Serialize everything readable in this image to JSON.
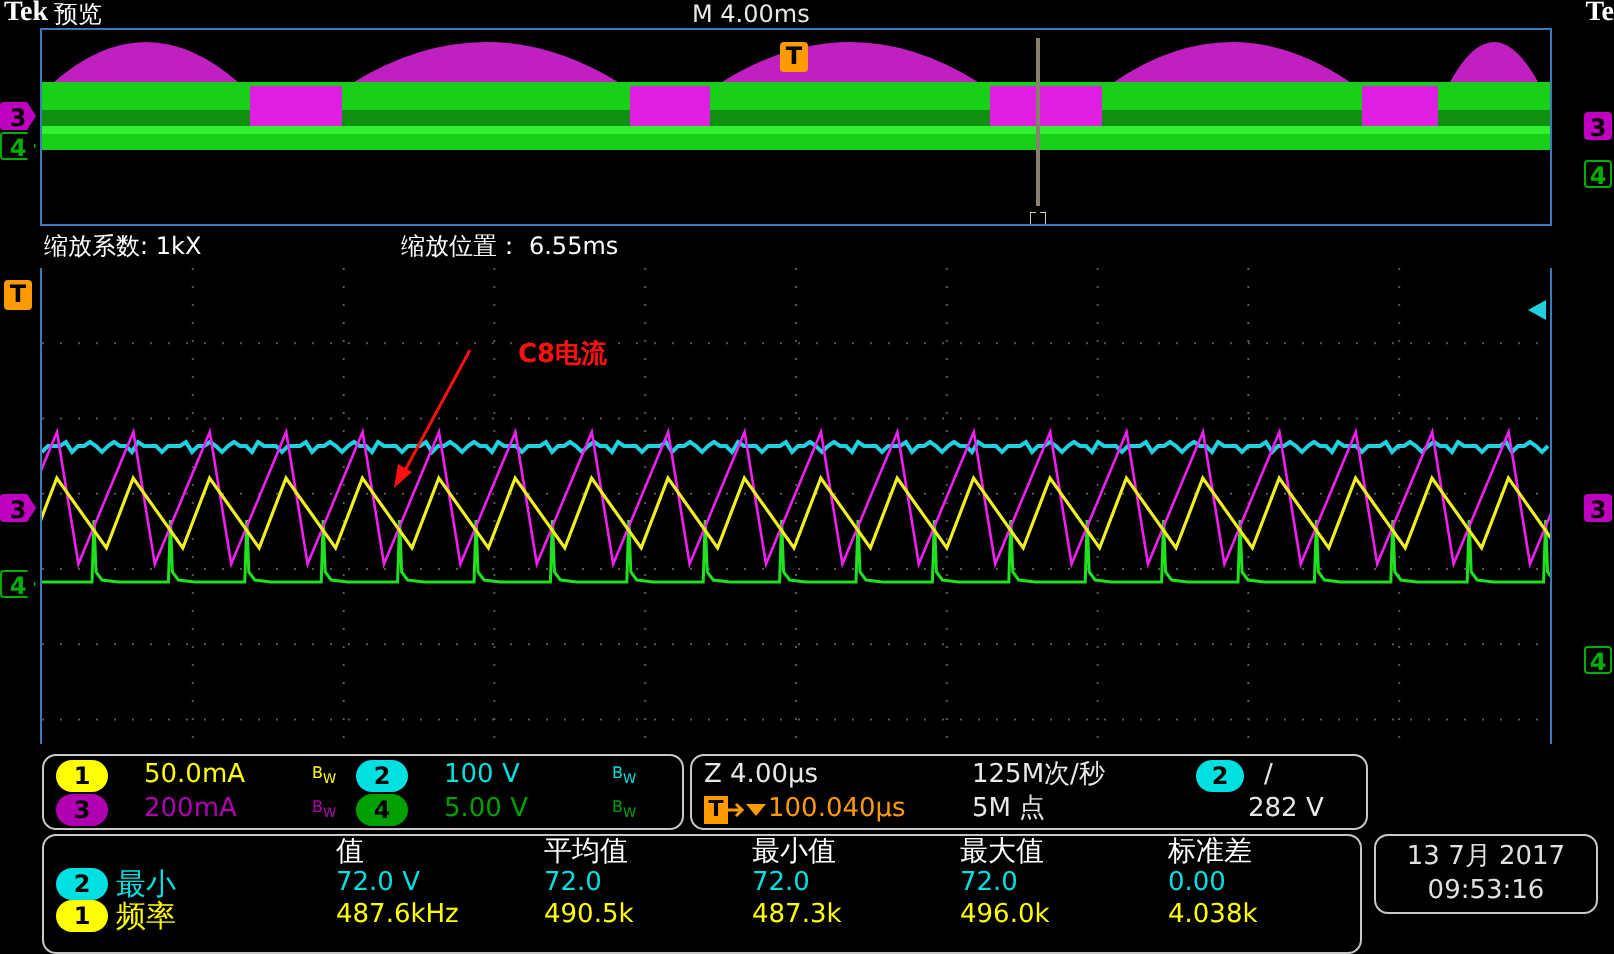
{
  "header": {
    "brand": "Tek",
    "title": "预览",
    "timebase": "M 4.00ms",
    "right_brand": "Te"
  },
  "overview": {
    "trigger": "T",
    "left_markers": [
      {
        "label": "3",
        "color": "#c000c0"
      },
      {
        "label": "4",
        "color": "#00b000"
      }
    ],
    "right_markers": [
      {
        "label": "3",
        "color": "#c000c0"
      },
      {
        "label": "4",
        "color": "#00b000"
      }
    ]
  },
  "zoom": {
    "factor": "缩放系数: 1kX",
    "position": "缩放位置： 6.55ms"
  },
  "display": {
    "trigger": "T",
    "annotation": "C8电流",
    "left_markers": [
      {
        "label": "3",
        "color": "#c000c0"
      },
      {
        "label": "4",
        "color": "#00b000"
      }
    ],
    "right_markers": [
      {
        "label": "3",
        "color": "#c000c0"
      },
      {
        "label": "4",
        "color": "#00b000"
      }
    ]
  },
  "channels": [
    {
      "number": "1",
      "scale": "50.0mA",
      "bw": "B$_{W}$",
      "color": "#ffff00"
    },
    {
      "number": "2",
      "scale": "100 V",
      "bw": "B$_{W}$",
      "color": "#00e0e0"
    },
    {
      "number": "3",
      "scale": "200mA",
      "bw": "B$_{W}$",
      "color": "#b000b0"
    },
    {
      "number": "4",
      "scale": "5.00 V",
      "bw": "B$_{W}$",
      "color": "#00a000"
    }
  ],
  "horizontal": {
    "zoom": "Z 4.00µs",
    "trigger_icon": "T",
    "trigger_delay": "100.040µs",
    "sample_rate": "125M次/秒",
    "record_length": "5M 点",
    "trigger_source": "2",
    "slope": "/",
    "trigger_level": "282 V"
  },
  "measurements": {
    "columns": [
      "值",
      "平均值",
      "最小值",
      "最大值",
      "标准差"
    ],
    "rows": [
      {
        "channel": "2",
        "color": "#00e0e0",
        "name": "最小",
        "values": [
          "72.0 V",
          "72.0",
          "72.0",
          "72.0",
          "0.00"
        ]
      },
      {
        "channel": "1",
        "color": "#ffff00",
        "name": "频率",
        "values": [
          "487.6kHz",
          "490.5k",
          "487.3k",
          "496.0k",
          "4.038k"
        ]
      }
    ]
  },
  "datetime": {
    "date": "13 7月 2017",
    "time": "09:53:16"
  }
}
